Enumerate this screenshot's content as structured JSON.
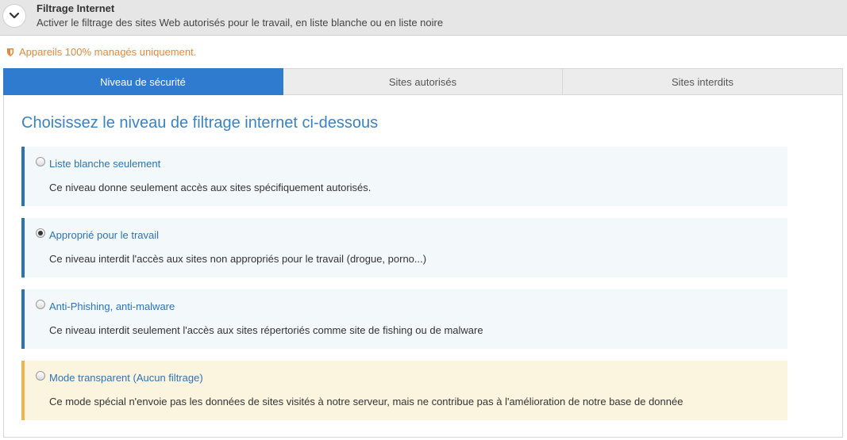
{
  "header": {
    "title": "Filtrage Internet",
    "subtitle": "Activer le filtrage des sites Web autorisés pour le travail, en liste blanche ou en liste noire",
    "toggle_icon": "chevron-down-icon"
  },
  "warning": {
    "text": "Appareils 100% managés uniquement.",
    "icon": "shield-icon",
    "color": "#e8883a"
  },
  "tabs": [
    {
      "label": "Niveau de sécurité",
      "active": true
    },
    {
      "label": "Sites autorisés",
      "active": false
    },
    {
      "label": "Sites interdits",
      "active": false
    }
  ],
  "colors": {
    "accent": "#2f7bd0",
    "title": "#3a83c3",
    "option_border": "#2a73b5",
    "warn_border": "#f0b54a"
  },
  "panel": {
    "title": "Choisissez le niveau de filtrage internet ci-dessous",
    "options": [
      {
        "label": "Liste blanche seulement",
        "description": "Ce niveau donne seulement accès aux sites spécifiquement autorisés.",
        "selected": false
      },
      {
        "label": "Approprié pour le travail",
        "description": "Ce niveau interdit l'accès aux sites non appropriés pour le travail (drogue, porno...)",
        "selected": true
      },
      {
        "label": "Anti-Phishing, anti-malware",
        "description": "Ce niveau interdit seulement l'accès aux sites répertoriés comme site de fishing ou de malware",
        "selected": false
      },
      {
        "label": "Mode transparent (Aucun filtrage)",
        "description": "Ce mode spécial n'envoie pas les données de sites visités à notre serveur, mais ne contribue pas à l'amélioration de notre base de donnée",
        "selected": false
      }
    ]
  }
}
